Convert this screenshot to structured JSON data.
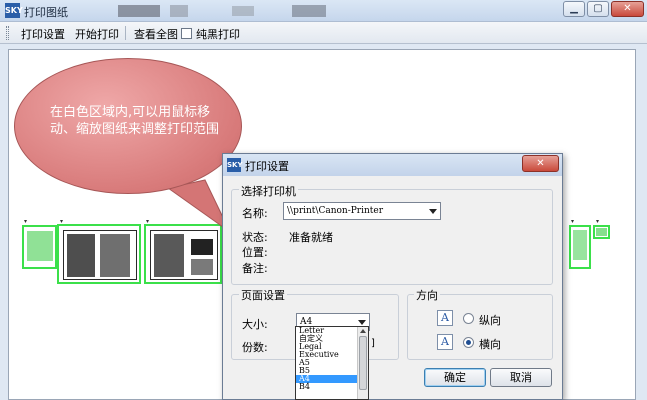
{
  "window": {
    "title": "打印图纸",
    "app_icon_text": "SKY"
  },
  "toolbar": {
    "print_settings": "打印设置",
    "start_print": "开始打印",
    "view_all": "查看全图",
    "pure_black_print": "纯黑打印",
    "pure_black_checked": false
  },
  "bubble": {
    "text": "在白色区域内,可以用鼠标移动、缩放图纸来调整打印范围"
  },
  "dialog": {
    "title": "打印设置",
    "printer_group": "选择打印机",
    "name_label": "名称:",
    "printer_name": "\\\\print\\Canon-Printer",
    "status_label": "状态:",
    "status_value": "准备就绪",
    "location_label": "位置:",
    "location_value": "",
    "comment_label": "备注:",
    "comment_value": "",
    "page_group": "页面设置",
    "size_label": "大小:",
    "size_value": "A4",
    "copies_label": "份数:",
    "orientation_group": "方向",
    "portrait_label": "纵向",
    "landscape_label": "横向",
    "orientation_selected": "横向",
    "ok_label": "确定",
    "cancel_label": "取消",
    "size_options": [
      "Letter",
      "自定义",
      "Legal",
      "Executive",
      "A5",
      "B5",
      "A4",
      "B4"
    ],
    "size_selected_index": 6
  },
  "colors": {
    "bubble_fill": "#d87a7a",
    "page_outline": "#3be04a",
    "selection": "#3399ff"
  }
}
